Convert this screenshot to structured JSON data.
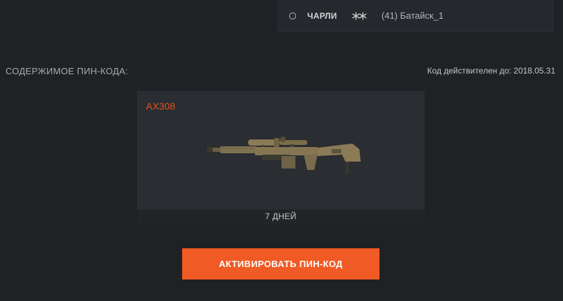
{
  "server": {
    "name": "ЧАРЛИ",
    "rank_icon": "snowflakes-icon",
    "channel": "(41) Батайск_1"
  },
  "pin": {
    "section_title": "СОДЕРЖИМОЕ ПИН-КОДА:",
    "valid_label": "Код действителен до: 2018.05.31"
  },
  "item": {
    "name": "AX308",
    "duration": "7 ДНЕЙ"
  },
  "actions": {
    "activate_label": "АКТИВИРОВАТЬ ПИН-КОД"
  },
  "colors": {
    "accent": "#f05a24",
    "item_name": "#e5501a",
    "background": "#1f2124",
    "card": "#2a2d31"
  }
}
